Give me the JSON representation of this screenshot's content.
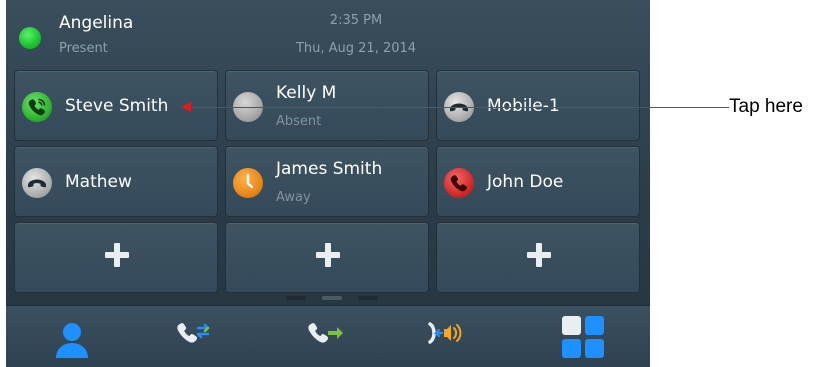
{
  "status": {
    "user_name": "Angelina",
    "presence": "Present",
    "time": "2:35 PM",
    "date": "Thu, Aug 21, 2014"
  },
  "tiles": [
    {
      "label": "Steve Smith",
      "sub": "",
      "icon": "active-call-icon",
      "color": "#2fb52f"
    },
    {
      "label": "Kelly M",
      "sub": "Absent",
      "icon": "absent-presence-icon",
      "color": "#9a9a9a"
    },
    {
      "label": "Mobile-1",
      "sub": "",
      "icon": "hangup-phone-icon",
      "color": "#9a9a9a"
    },
    {
      "label": "Mathew",
      "sub": "",
      "icon": "hangup-phone-icon",
      "color": "#9a9a9a"
    },
    {
      "label": "James Smith",
      "sub": "Away",
      "icon": "away-clock-icon",
      "color": "#e8891a"
    },
    {
      "label": "John Doe",
      "sub": "",
      "icon": "busy-phone-icon",
      "color": "#d42a2a"
    },
    {
      "label": "",
      "sub": "",
      "icon": "plus-icon",
      "color": "#e8eef2"
    },
    {
      "label": "",
      "sub": "",
      "icon": "plus-icon",
      "color": "#e8eef2"
    },
    {
      "label": "",
      "sub": "",
      "icon": "plus-icon",
      "color": "#e8eef2"
    }
  ],
  "bottom_nav": [
    {
      "icon": "contacts-icon"
    },
    {
      "icon": "transfer-call-icon"
    },
    {
      "icon": "forward-call-icon"
    },
    {
      "icon": "intercom-icon"
    },
    {
      "icon": "apps-grid-icon"
    }
  ],
  "annotation": {
    "text": "Tap here"
  },
  "colors": {
    "accent_blue": "#1e90ff",
    "annotation_red": "#e21a1a",
    "present_green": "#19c22f"
  }
}
